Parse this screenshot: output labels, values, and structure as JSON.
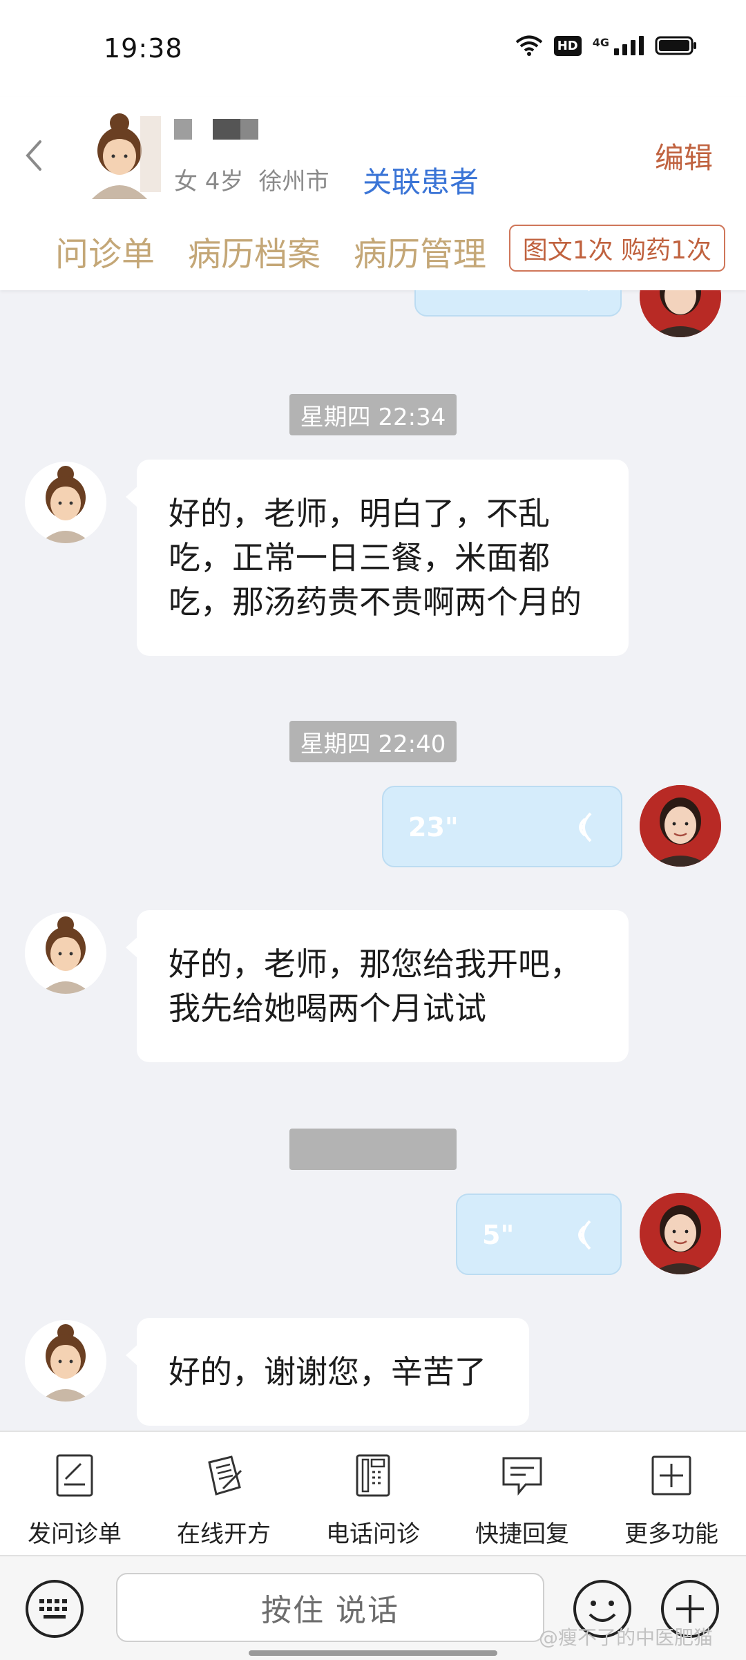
{
  "status_bar": {
    "time": "19:38",
    "hd_label": "HD",
    "network_label": "4G"
  },
  "header": {
    "patient_sex_age": "女 4岁",
    "patient_city": "徐州市",
    "link_patient_label": "关联患者",
    "edit_label": "编辑",
    "tabs": [
      {
        "label": "问诊单"
      },
      {
        "label": "病历档案"
      },
      {
        "label": "病历管理"
      }
    ],
    "quota_badge": "图文1次 购药1次"
  },
  "chat": {
    "messages": [
      {
        "type": "time",
        "text": "星期四 22:34"
      },
      {
        "type": "text",
        "sender": "patient",
        "lines": [
          "好的，老师，明白了，不乱",
          "吃，正常一日三餐，米面都",
          "吃，那汤药贵不贵啊两个月的"
        ]
      },
      {
        "type": "time",
        "text": "星期四 22:40"
      },
      {
        "type": "voice",
        "sender": "doctor",
        "duration": "23\""
      },
      {
        "type": "text",
        "sender": "patient",
        "lines": [
          "好的，老师，那您给我开吧，",
          "我先给她喝两个月试试"
        ]
      },
      {
        "type": "time",
        "text": ""
      },
      {
        "type": "voice",
        "sender": "doctor",
        "duration": "5\""
      },
      {
        "type": "text",
        "sender": "patient",
        "lines": [
          "好的，谢谢您，辛苦了"
        ]
      }
    ]
  },
  "functions": [
    {
      "label": "发问诊单",
      "icon": "inquiry-form-icon"
    },
    {
      "label": "在线开方",
      "icon": "prescription-icon"
    },
    {
      "label": "电话问诊",
      "icon": "phone-icon"
    },
    {
      "label": "快捷回复",
      "icon": "quick-reply-icon"
    },
    {
      "label": "更多功能",
      "icon": "more-functions-icon"
    }
  ],
  "input_bar": {
    "talk_label": "按住 说话",
    "watermark": "@瘦不了的中医肥猫"
  },
  "colors": {
    "accent_tab": "#c4a777",
    "edit": "#c0623f",
    "link": "#3a74d6",
    "voice_bubble": "#d5ecfb",
    "time_pill": "#b3b3b3"
  }
}
